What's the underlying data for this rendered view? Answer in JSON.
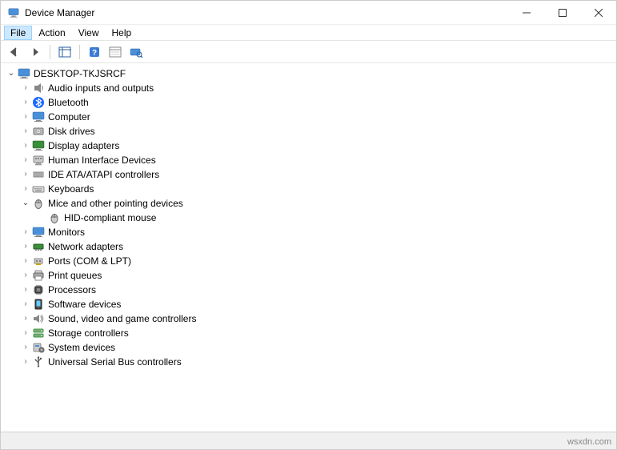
{
  "window": {
    "title": "Device Manager"
  },
  "menu": {
    "items": [
      "File",
      "Action",
      "View",
      "Help"
    ],
    "selected_index": 0
  },
  "toolbar": {
    "buttons": [
      "back",
      "forward",
      "show-hidden",
      "help",
      "properties",
      "scan-hardware"
    ]
  },
  "tree": {
    "root": {
      "label": "DESKTOP-TKJSRCF",
      "expanded": true,
      "icon": "computer-icon"
    },
    "categories": [
      {
        "label": "Audio inputs and outputs",
        "expanded": false,
        "icon": "audio-icon"
      },
      {
        "label": "Bluetooth",
        "expanded": false,
        "icon": "bluetooth-icon"
      },
      {
        "label": "Computer",
        "expanded": false,
        "icon": "monitor-icon"
      },
      {
        "label": "Disk drives",
        "expanded": false,
        "icon": "disk-icon"
      },
      {
        "label": "Display adapters",
        "expanded": false,
        "icon": "display-icon"
      },
      {
        "label": "Human Interface Devices",
        "expanded": false,
        "icon": "hid-icon"
      },
      {
        "label": "IDE ATA/ATAPI controllers",
        "expanded": false,
        "icon": "ide-icon"
      },
      {
        "label": "Keyboards",
        "expanded": false,
        "icon": "keyboard-icon"
      },
      {
        "label": "Mice and other pointing devices",
        "expanded": true,
        "icon": "mouse-icon",
        "children": [
          {
            "label": "HID-compliant mouse",
            "icon": "mouse-icon"
          }
        ]
      },
      {
        "label": "Monitors",
        "expanded": false,
        "icon": "monitor-icon"
      },
      {
        "label": "Network adapters",
        "expanded": false,
        "icon": "network-icon"
      },
      {
        "label": "Ports (COM & LPT)",
        "expanded": false,
        "icon": "port-icon"
      },
      {
        "label": "Print queues",
        "expanded": false,
        "icon": "printer-icon"
      },
      {
        "label": "Processors",
        "expanded": false,
        "icon": "processor-icon"
      },
      {
        "label": "Software devices",
        "expanded": false,
        "icon": "software-icon"
      },
      {
        "label": "Sound, video and game controllers",
        "expanded": false,
        "icon": "sound-icon"
      },
      {
        "label": "Storage controllers",
        "expanded": false,
        "icon": "storage-icon"
      },
      {
        "label": "System devices",
        "expanded": false,
        "icon": "system-icon"
      },
      {
        "label": "Universal Serial Bus controllers",
        "expanded": false,
        "icon": "usb-icon"
      }
    ]
  },
  "watermark": "wsxdn.com"
}
